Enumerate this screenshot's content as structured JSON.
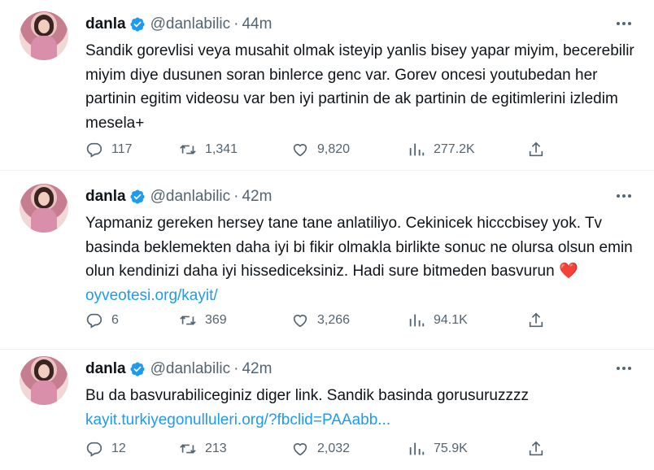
{
  "colors": {
    "link": "#1d9bf0",
    "muted": "#536471",
    "verified": "#1d9bf0",
    "heart": "#c41d2f"
  },
  "tweets": [
    {
      "name": "danla",
      "handle": "@danlabilic",
      "dot": "·",
      "time": "44m",
      "text": "Sandik gorevlisi veya musahit olmak isteyip yanlis bisey yapar miyim, becerebilir miyim diye dusunen soran binlerce genc var. Gorev oncesi youtubedan her partinin egitim videosu var ben iyi partinin de ak partinin de egitimlerini izledim mesela+",
      "link": "",
      "replies": "117",
      "retweets": "1,341",
      "likes": "9,820",
      "views": "277.2K"
    },
    {
      "name": "danla",
      "handle": "@danlabilic",
      "dot": "·",
      "time": "42m",
      "text": "Yapmaniz gereken hersey tane tane anlatiliyo. Cekinicek hicccbisey yok. Tv basinda beklemekten daha iyi bi fikir olmakla birlikte sonuc ne olursa olsun emin olun kendinizi daha iyi hissediceksiniz. Hadi sure bitmeden basvurun",
      "emoji": "❤️",
      "link": "oyveotesi.org/kayit/",
      "replies": "6",
      "retweets": "369",
      "likes": "3,266",
      "views": "94.1K"
    },
    {
      "name": "danla",
      "handle": "@danlabilic",
      "dot": "·",
      "time": "42m",
      "text": "Bu da basvurabiliceginiz diger link. Sandik basinda gorusuruzzzz",
      "link": "kayit.turkiyegonulluleri.org/?fbclid=PAAabb...",
      "replies": "12",
      "retweets": "213",
      "likes": "2,032",
      "views": "75.9K"
    }
  ],
  "icons": {
    "reply": "reply-icon",
    "retweet": "retweet-icon",
    "like": "heart-icon",
    "views": "views-icon",
    "share": "share-icon",
    "more": "more-icon",
    "verified": "verified-badge-icon"
  }
}
